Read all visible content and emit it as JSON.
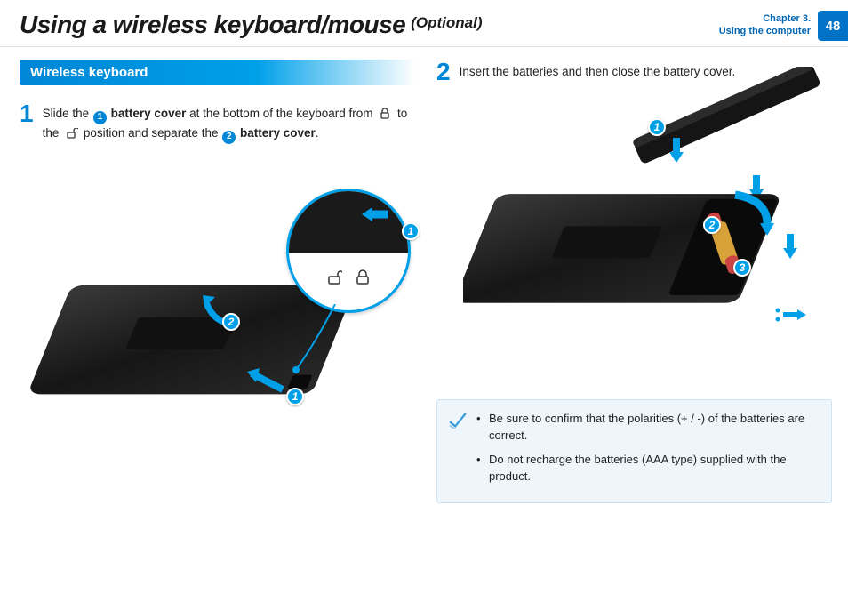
{
  "header": {
    "title": "Using a wireless keyboard/mouse",
    "optional": "(Optional)",
    "chapter_line1": "Chapter 3.",
    "chapter_line2": "Using the computer",
    "page_number": "48"
  },
  "section_title": "Wireless keyboard",
  "steps": {
    "s1": {
      "num": "1",
      "parts": {
        "a": "Slide the ",
        "b": " battery cover",
        "c": " at the bottom of the keyboard from ",
        "d": " to the ",
        "e": " position and separate the ",
        "f": " battery cover",
        "g": "."
      },
      "inline_callout_1": "1",
      "inline_callout_2": "2"
    },
    "s2": {
      "num": "2",
      "text": "Insert the batteries and then close the battery cover."
    }
  },
  "figure1_callouts": {
    "c1": "1",
    "c2": "2",
    "zoom_c1": "1"
  },
  "figure2_callouts": {
    "c1": "1",
    "c2": "2",
    "c3": "3"
  },
  "notes": {
    "n1": "Be sure to confirm that the polarities (+ / -) of the batteries are correct.",
    "n2": "Do not recharge the batteries (AAA type) supplied with the product."
  }
}
